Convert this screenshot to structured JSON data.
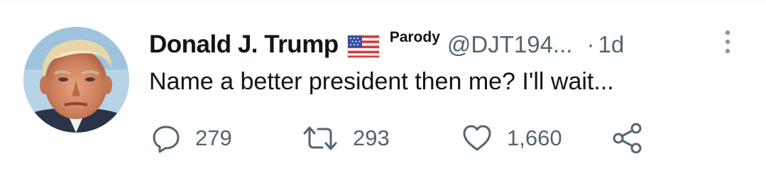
{
  "tweet": {
    "display_name": "Donald J. Trump",
    "flag_icon": "us-flag-icon",
    "parody_label": "Parody",
    "handle": "@DJT194...",
    "separator": "·",
    "timestamp": "1d",
    "text": "Name a better president then me? I'll wait...",
    "more_icon": "more-vertical-icon"
  },
  "actions": {
    "reply": {
      "icon": "reply-bubble-icon",
      "count": "279"
    },
    "retweet": {
      "icon": "retweet-icon",
      "count": "293"
    },
    "like": {
      "icon": "heart-icon",
      "count": "1,660"
    },
    "share": {
      "icon": "share-icon"
    }
  },
  "colors": {
    "text_primary": "#0f1419",
    "text_secondary": "#536471",
    "background": "#ffffff",
    "flag_red": "#d83a3a",
    "flag_blue": "#3b4fa3"
  }
}
